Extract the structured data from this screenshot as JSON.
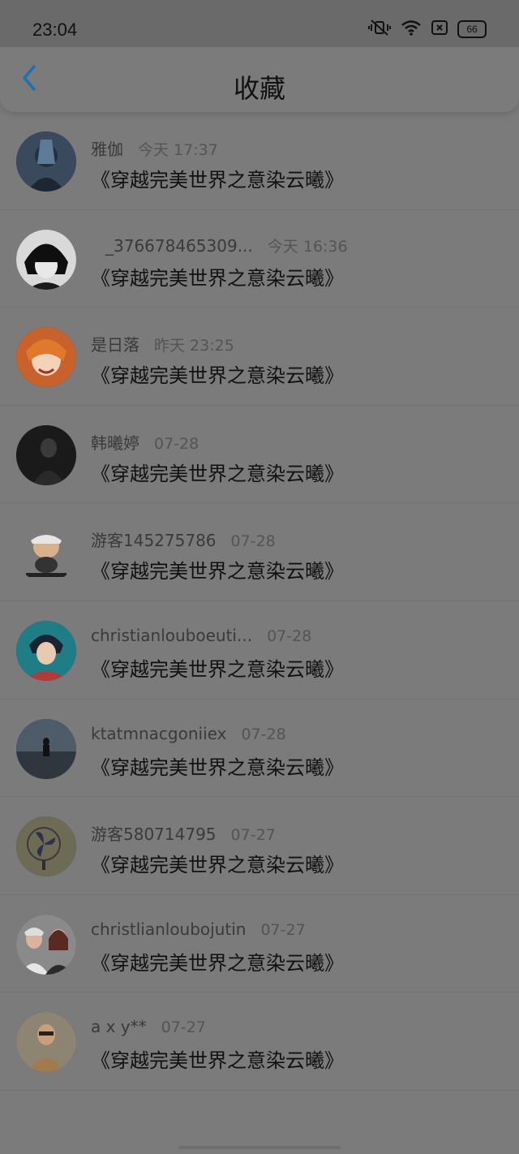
{
  "status_bar": {
    "time": "23:04",
    "battery": "66",
    "icons": [
      "vibrate-mute-icon",
      "wifi-icon",
      "sim-icon",
      "battery-icon"
    ]
  },
  "header": {
    "title": "收藏",
    "back_icon": "chevron-left-icon"
  },
  "colors": {
    "accent": "#1e6fb8",
    "background": "#7b7b7b",
    "status_bar": "#6a6a6a"
  },
  "items": [
    {
      "name": "雅伽",
      "time": "今天 17:37",
      "title": "《穿越完美世界之意染云曦》",
      "avatar": "avatar-anime-girl-icon"
    },
    {
      "name": "_376678465309...",
      "time": "今天 16:36",
      "title": "《穿越完美世界之意染云曦》",
      "avatar": "avatar-anime-boy-icon"
    },
    {
      "name": "是日落",
      "time": "昨天 23:25",
      "title": "《穿越完美世界之意染云曦》",
      "avatar": "avatar-orange-hair-icon"
    },
    {
      "name": "韩曦婷",
      "time": "07-28",
      "title": "《穿越完美世界之意染云曦》",
      "avatar": "avatar-dark-photo-icon"
    },
    {
      "name": "游客145275786",
      "time": "07-28",
      "title": "《穿越完美世界之意染云曦》",
      "avatar": "avatar-cartoon-icon"
    },
    {
      "name": "christianlouboeuti...",
      "time": "07-28",
      "title": "《穿越完美世界之意染云曦》",
      "avatar": "avatar-hoodie-boy-icon"
    },
    {
      "name": "ktatmnacgoniiex",
      "time": "07-28",
      "title": "《穿越完美世界之意染云曦》",
      "avatar": "avatar-sky-silhouette-icon"
    },
    {
      "name": "游客580714795",
      "time": "07-27",
      "title": "《穿越完美世界之意染云曦》",
      "avatar": "avatar-fan-icon"
    },
    {
      "name": "christlianloubojutin",
      "time": "07-27",
      "title": "《穿越完美世界之意染云曦》",
      "avatar": "avatar-couple-icon"
    },
    {
      "name": "a x y**",
      "time": "07-27",
      "title": "《穿越完美世界之意染云曦》",
      "avatar": "avatar-sketch-icon"
    }
  ]
}
